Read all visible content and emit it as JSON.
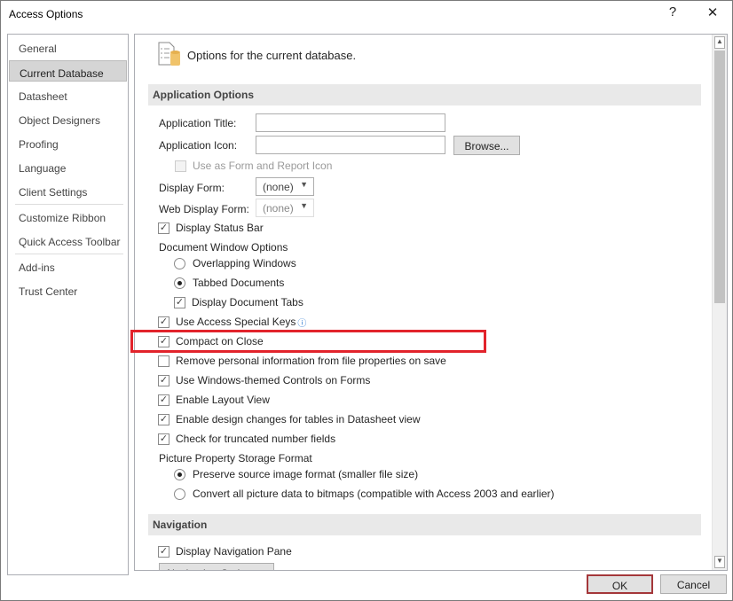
{
  "window": {
    "title": "Access Options",
    "help": "?",
    "close": "✕"
  },
  "sidebar": {
    "items": [
      {
        "label": "General"
      },
      {
        "label": "Current Database",
        "selected": true
      },
      {
        "label": "Datasheet"
      },
      {
        "label": "Object Designers"
      },
      {
        "label": "Proofing"
      },
      {
        "label": "Language"
      },
      {
        "label": "Client Settings"
      },
      {
        "label": "Customize Ribbon"
      },
      {
        "label": "Quick Access Toolbar"
      },
      {
        "label": "Add-ins"
      },
      {
        "label": "Trust Center"
      }
    ]
  },
  "main": {
    "heading": "Options for the current database.",
    "app_section": "Application Options",
    "app_title_label": "Application Title:",
    "app_title_value": "",
    "app_icon_label": "Application Icon:",
    "app_icon_value": "",
    "browse": "Browse...",
    "use_as_icon": "Use as Form and Report Icon",
    "display_form_label": "Display Form:",
    "display_form_value": "(none)",
    "web_form_label": "Web Display Form:",
    "web_form_value": "(none)",
    "display_status_bar": "Display Status Bar",
    "doc_window_options": "Document Window Options",
    "overlapping": "Overlapping Windows",
    "tabbed": "Tabbed Documents",
    "display_tabs": "Display Document Tabs",
    "special_keys": "Use Access Special Keys",
    "compact": "Compact on Close",
    "remove_personal": "Remove personal information from file properties on save",
    "windows_themed": "Use Windows-themed Controls on Forms",
    "layout_view": "Enable Layout View",
    "design_changes": "Enable design changes for tables in Datasheet view",
    "truncated": "Check for truncated number fields",
    "picture_storage": "Picture Property Storage Format",
    "preserve": "Preserve source image format (smaller file size)",
    "convert": "Convert all picture data to bitmaps (compatible with Access 2003 and earlier)",
    "nav_section": "Navigation",
    "display_nav": "Display Navigation Pane",
    "nav_options": "Navigation Options..."
  },
  "footer": {
    "ok": "OK",
    "cancel": "Cancel"
  },
  "colors": {
    "highlight": "#e2232b",
    "ok_border": "#a4373a"
  }
}
